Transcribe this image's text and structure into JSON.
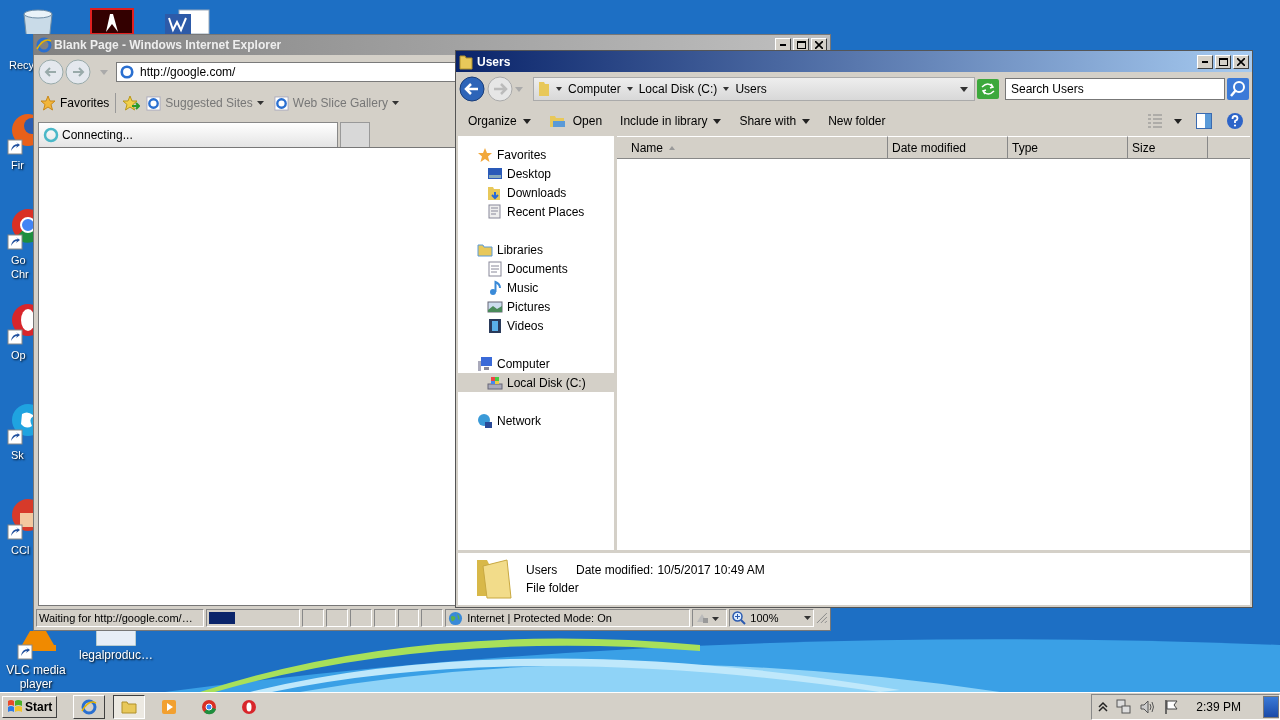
{
  "desktop": {
    "icons": [
      {
        "kind": "bin",
        "lines": [
          "Recy"
        ]
      },
      {
        "kind": "fox",
        "lines": [
          "Fir"
        ]
      },
      {
        "kind": "ring",
        "lines": [
          "Go",
          "Chr"
        ]
      },
      {
        "kind": "o",
        "lines": [
          "Op"
        ]
      },
      {
        "kind": "cloud",
        "lines": [
          "Sk"
        ]
      },
      {
        "kind": "brush",
        "lines": [
          "CCl"
        ]
      },
      {
        "kind": "cone",
        "lines": [
          "VLC media",
          "player"
        ]
      },
      {
        "kind": "doc",
        "lines": [
          "legalproduc…"
        ]
      }
    ]
  },
  "ie_window": {
    "title": "Blank Page - Windows Internet Explorer",
    "address": "http://google.com/",
    "favorites": "Favorites",
    "links": [
      {
        "label": "Suggested Sites"
      },
      {
        "label": "Web Slice Gallery"
      }
    ],
    "tab": "Connecting...",
    "status_bar": {
      "text": "Waiting for http://google.com/…",
      "level": 0.3,
      "zone": "Internet | Protected Mode: On",
      "zoom": "100%"
    }
  },
  "explorer_window": {
    "title": "Users",
    "breadcrumb": [
      "Computer",
      "Local Disk (C:)",
      "Users"
    ],
    "search": {
      "placeholder": "Search Users"
    },
    "toolbar": [
      {
        "label": "Organize",
        "kind": "menu"
      },
      {
        "label": "Open",
        "kind": "open"
      },
      {
        "label": "Include in library",
        "kind": "menu"
      },
      {
        "label": "Share with",
        "kind": "menu"
      },
      {
        "label": "New folder",
        "kind": "plain"
      }
    ],
    "nav": [
      {
        "label": "Favorites",
        "kind": "star",
        "selected": false,
        "children": [
          {
            "label": "Desktop",
            "kind": "desktop",
            "selected": false
          },
          {
            "label": "Downloads",
            "kind": "download",
            "selected": false
          },
          {
            "label": "Recent Places",
            "kind": "recent",
            "selected": false
          }
        ]
      },
      {
        "label": "Libraries",
        "kind": "library",
        "selected": false,
        "children": [
          {
            "label": "Documents",
            "kind": "document",
            "selected": false
          },
          {
            "label": "Music",
            "kind": "music",
            "selected": false
          },
          {
            "label": "Pictures",
            "kind": "picture",
            "selected": false
          },
          {
            "label": "Videos",
            "kind": "video",
            "selected": false
          }
        ]
      },
      {
        "label": "Computer",
        "kind": "computer",
        "selected": false,
        "children": [
          {
            "label": "Local Disk (C:)",
            "kind": "disk",
            "selected": true
          }
        ]
      },
      {
        "label": "Network",
        "kind": "network",
        "selected": false
      }
    ],
    "columns": [
      "Name",
      "Date modified",
      "Type",
      "Size"
    ],
    "details": {
      "name": "Users",
      "date_label": "Date modified:",
      "date": "10/5/2017 10:49 AM",
      "type": "File folder"
    }
  },
  "taskbar": {
    "start": "Start",
    "apps": [
      {
        "kind": "ie",
        "running": true,
        "selected": false
      },
      {
        "kind": "folder",
        "running": true,
        "selected": true
      },
      {
        "kind": "player",
        "running": false,
        "selected": false
      },
      {
        "kind": "ring",
        "running": false,
        "selected": false
      },
      {
        "kind": "o",
        "running": false,
        "selected": false
      }
    ],
    "time": "2:39 PM"
  }
}
